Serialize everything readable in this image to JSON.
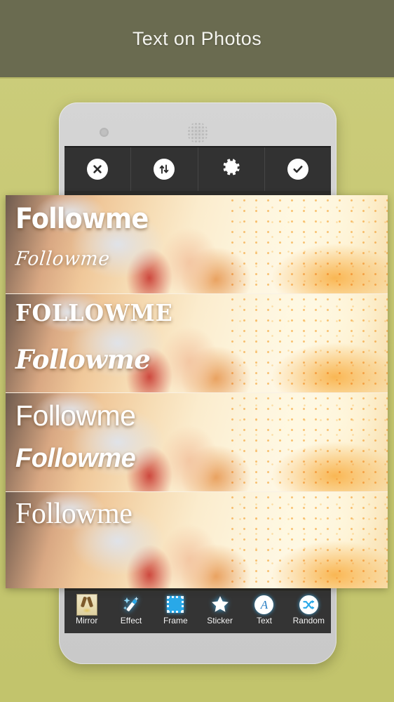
{
  "header": {
    "title": "Text on Photos",
    "bg_color": "#6a6b50",
    "text_color": "#f4f4ef"
  },
  "background": {
    "color": "#c8c977"
  },
  "device": {
    "body_color": "#d0d0d0",
    "camera_icon": "camera-dot-icon",
    "speaker_icon": "speaker-grille-icon"
  },
  "editor": {
    "top_toolbar": {
      "bg_color": "#323232",
      "buttons": [
        {
          "name": "close",
          "label": "Close",
          "icon": "close-circle-icon"
        },
        {
          "name": "swap",
          "label": "Swap",
          "icon": "arrows-up-down-circle-icon"
        },
        {
          "name": "settings",
          "label": "Settings",
          "icon": "gear-icon"
        },
        {
          "name": "confirm",
          "label": "Done",
          "icon": "check-circle-icon"
        }
      ]
    },
    "bottom_toolbar": {
      "bg_color": "#343434",
      "accent_color": "#29a8e8",
      "items": [
        {
          "label": "Mirror",
          "icon": "mirror-thumbnail-icon"
        },
        {
          "label": "Effect",
          "icon": "magic-wand-icon"
        },
        {
          "label": "Frame",
          "icon": "frame-square-icon"
        },
        {
          "label": "Sticker",
          "icon": "star-icon"
        },
        {
          "label": "Text",
          "icon": "letter-a-circle-icon"
        },
        {
          "label": "Random",
          "icon": "shuffle-circle-icon"
        }
      ]
    },
    "preview": {
      "photo_alt": "Girl in white knit pompom hat and red coat laughing at golden sunset",
      "text_samples": [
        {
          "text": "Followme",
          "style": "bold-condensed-blue",
          "color": "#3f8fd8"
        },
        {
          "text": "Followme",
          "style": "handwritten-script-white",
          "color": "#ffffff"
        },
        {
          "text": "FOLLOWME",
          "style": "bold-slab-uppercase-white",
          "color": "#ffffff"
        },
        {
          "text": "Followme",
          "style": "bold-italic-serif-white",
          "color": "#ffffff"
        },
        {
          "text": "Followme",
          "style": "light-sans-white",
          "color": "#ffffff"
        },
        {
          "text": "Followme",
          "style": "bold-italic-sans-white",
          "color": "#ffffff"
        },
        {
          "text": "Followme",
          "style": "regular-serif-white",
          "color": "#ffffff"
        }
      ]
    }
  }
}
